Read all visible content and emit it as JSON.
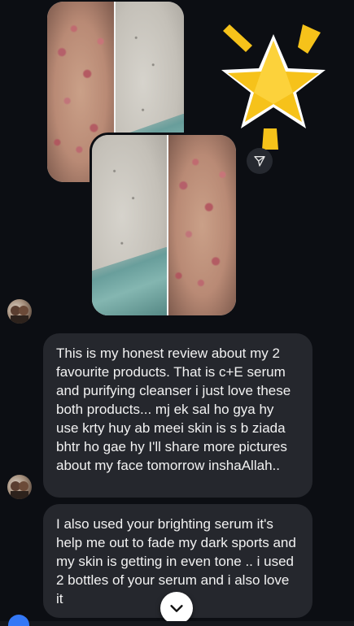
{
  "messages": [
    {
      "text": "This is my honest review about my 2 favourite products. That is c+E serum and purifying cleanser i just love these both products... mj ek sal ho gya hy use krty huy ab meei skin is s b ziada bhtr ho gae hy I'll share more pictures about my face tomorrow inshaAllah.."
    },
    {
      "text": "I also used your brighting serum it's help me out to fade my dark sports and my skin is getting in even tone .. i used 2 bottles of your serum and i also love it"
    }
  ],
  "icons": {
    "share": "paper-plane-icon",
    "sticker": "star-sticker",
    "scroll": "chevron-down-icon"
  },
  "colors": {
    "background": "#0c0e13",
    "bubble": "#25272d",
    "star_fill": "#f6c21a",
    "accent": "#3478f6"
  }
}
